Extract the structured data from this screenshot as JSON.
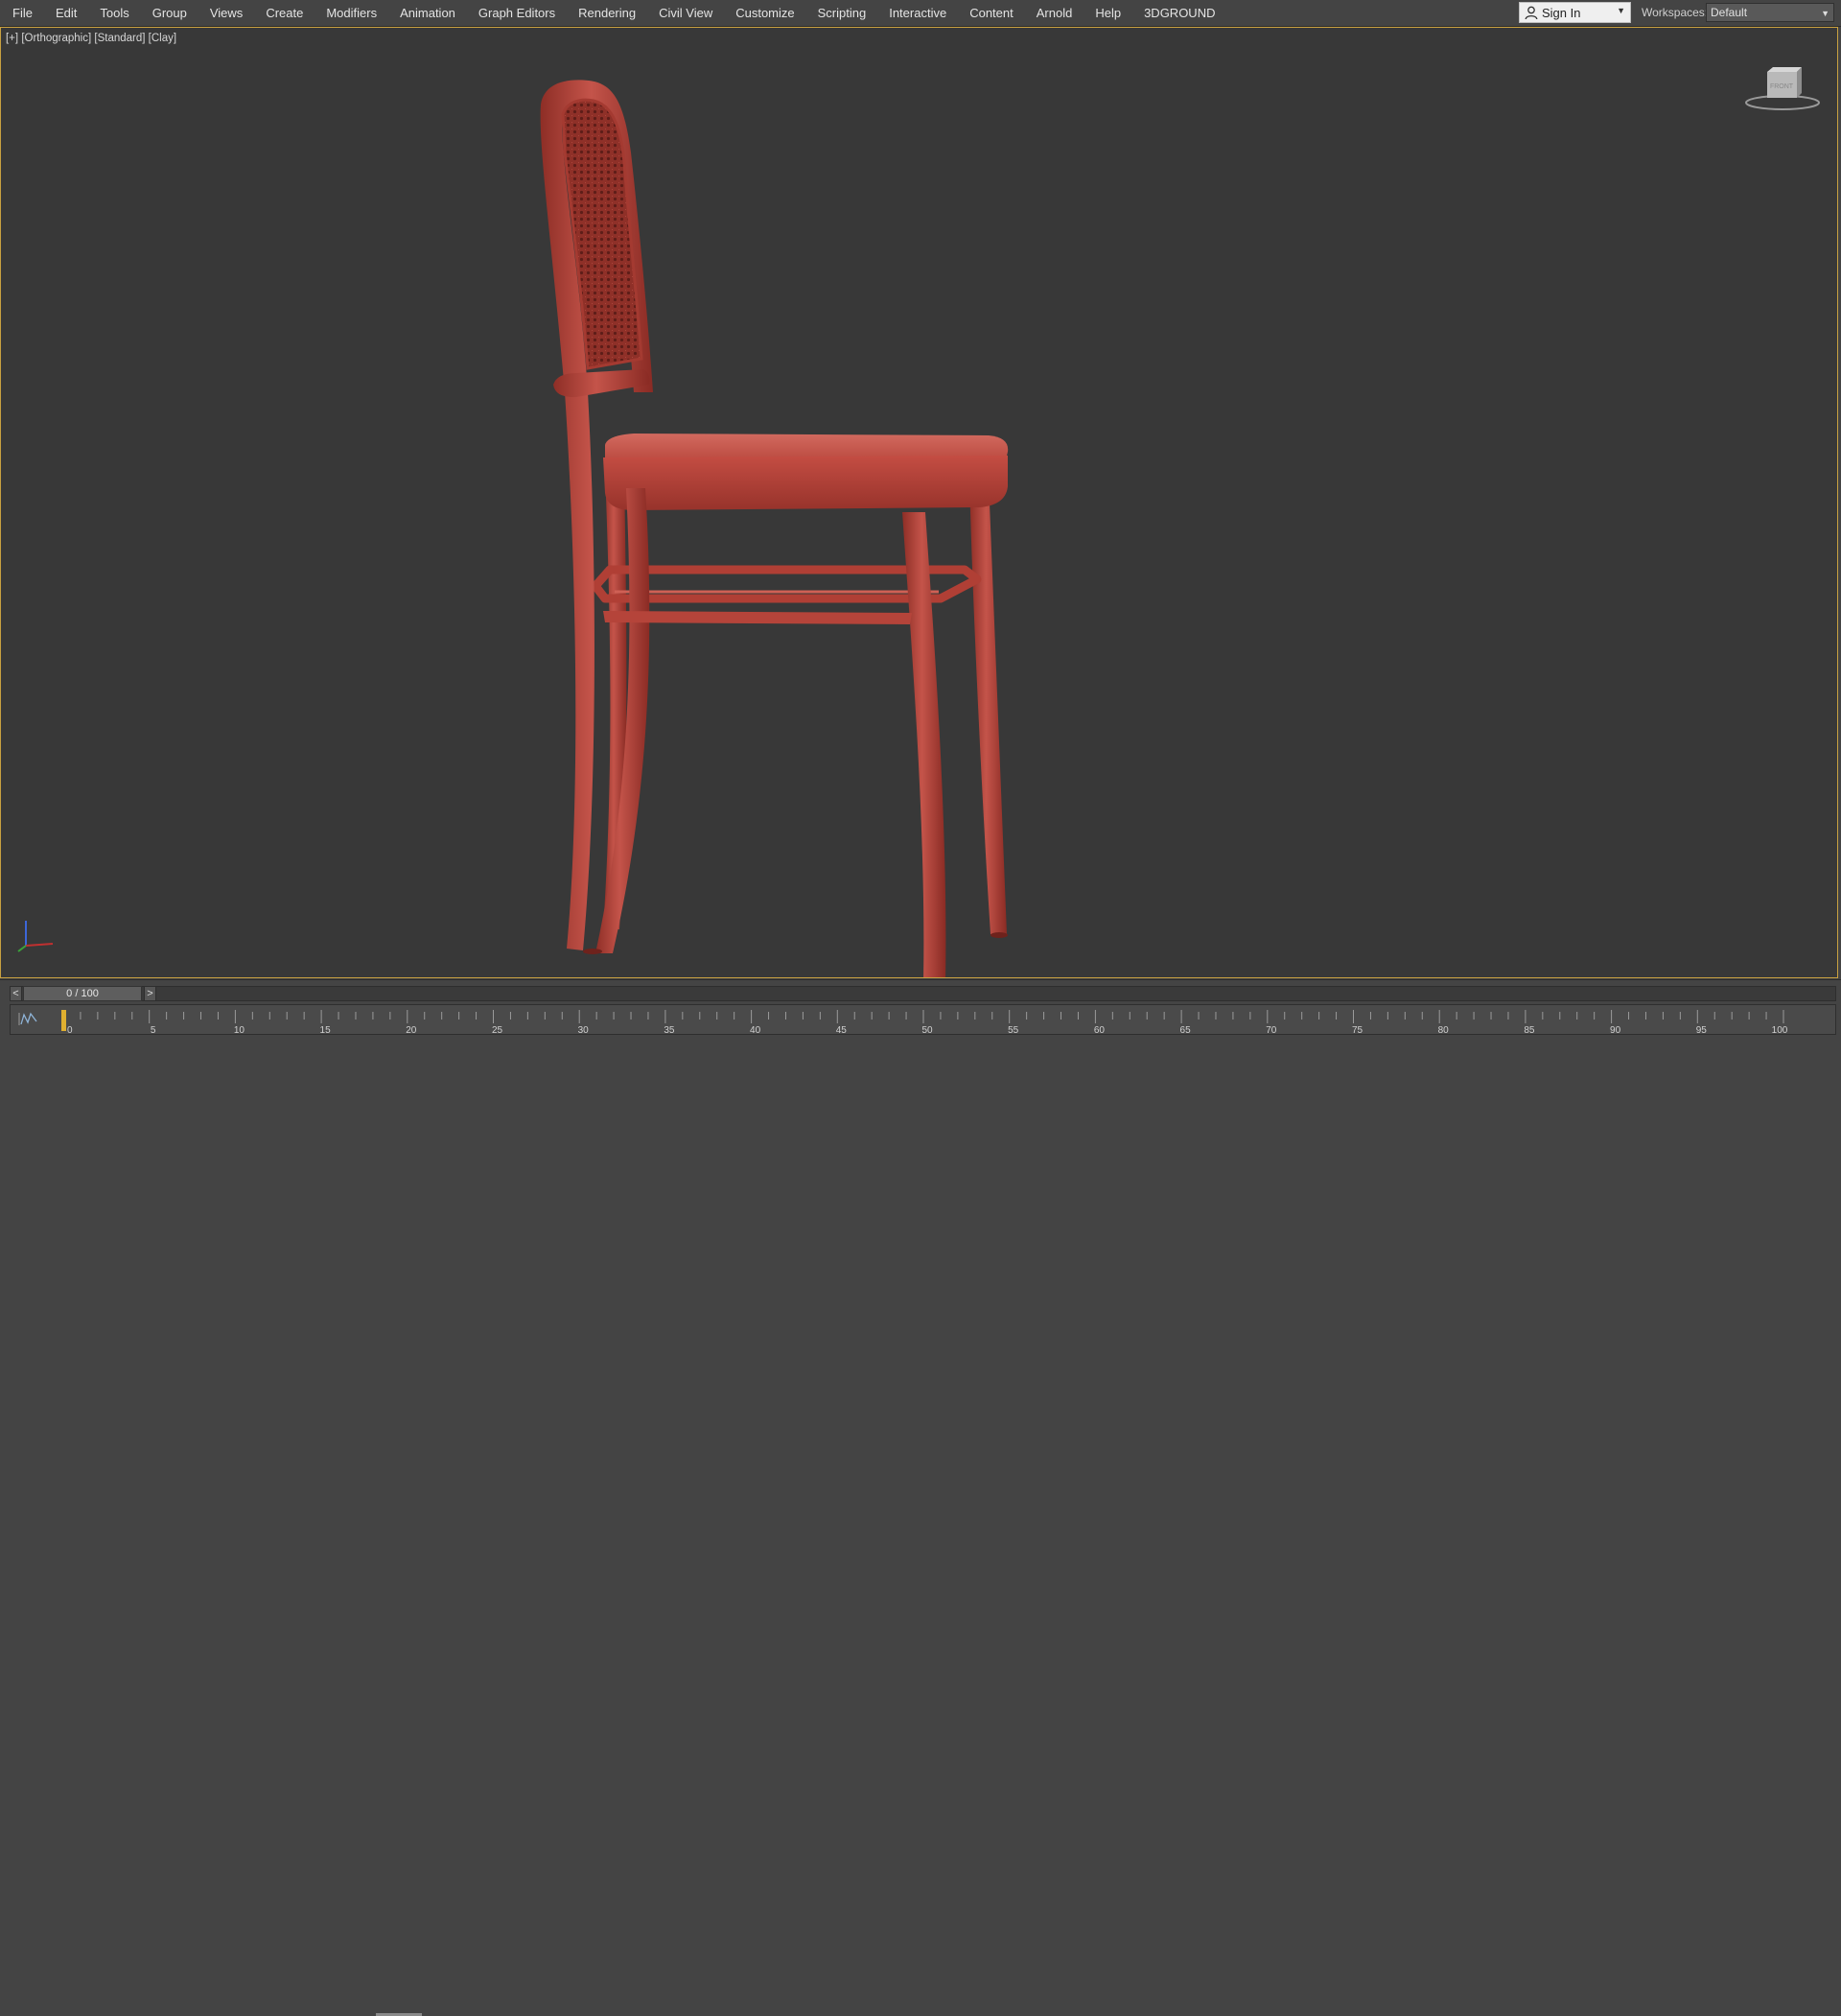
{
  "menu": {
    "items": [
      "File",
      "Edit",
      "Tools",
      "Group",
      "Views",
      "Create",
      "Modifiers",
      "Animation",
      "Graph Editors",
      "Rendering",
      "Civil View",
      "Customize",
      "Scripting",
      "Interactive",
      "Content",
      "Arnold",
      "Help",
      "3DGROUND"
    ]
  },
  "account": {
    "sign_in_label": "Sign In"
  },
  "workspaces": {
    "label": "Workspaces:",
    "value": "Default"
  },
  "viewport": {
    "label_plus": "[+]",
    "label_view": "[Orthographic]",
    "label_shading": "[Standard]",
    "label_style": "[Clay]",
    "viewcube_face": "FRONT"
  },
  "timeline": {
    "frame_display": "0 / 100",
    "prev_label": "<",
    "next_label": ">",
    "current_frame": 0,
    "ticks": [
      "0",
      "5",
      "10",
      "15",
      "20",
      "25",
      "30",
      "35",
      "40",
      "45",
      "50",
      "55",
      "60",
      "65",
      "70",
      "75",
      "80",
      "85",
      "90",
      "95",
      "100"
    ]
  },
  "colors": {
    "ui_background": "#444444",
    "viewport_background": "#383838",
    "active_viewport_border": "#c8a040",
    "model_clay": "#b8453b"
  },
  "icons": [
    "user-icon",
    "chevron-down-icon",
    "viewcube-icon",
    "axis-tripod-icon",
    "curve-editor-icon"
  ]
}
